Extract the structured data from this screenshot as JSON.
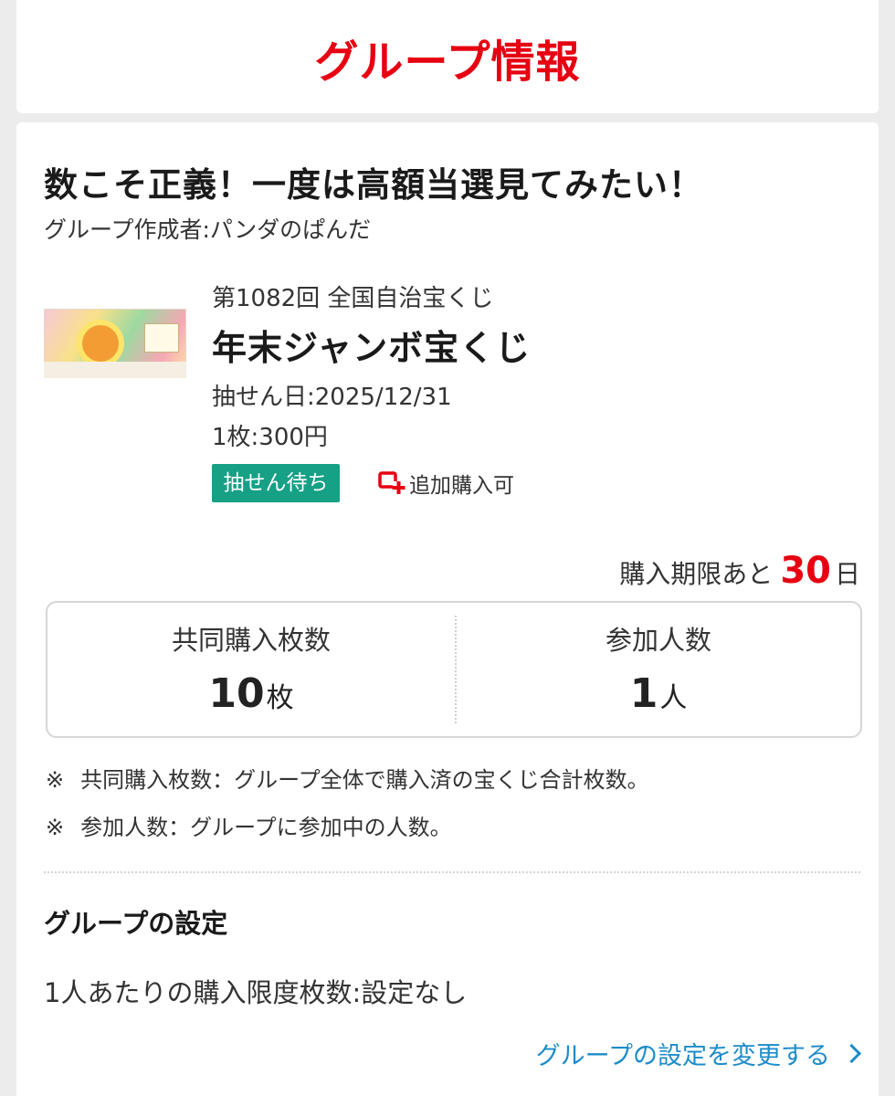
{
  "header": {
    "title": "グループ情報"
  },
  "group": {
    "name": "数こそ正義！一度は高額当選見てみたい！",
    "creator": "グループ作成者:パンダのぱんだ"
  },
  "lottery": {
    "round": "第1082回 全国自治宝くじ",
    "name": "年末ジャンボ宝くじ",
    "draw_date": "抽せん日:2025/12/31",
    "price": "1枚:300円",
    "status_badge": "抽せん待ち",
    "additional_purchase": "追加購入可",
    "image_icon": "lottery-ticket-image",
    "badge_color": "#16a085"
  },
  "deadline": {
    "prefix": "購入期限あと",
    "days": "30",
    "suffix": "日"
  },
  "stats": {
    "joint_label": "共同購入枚数",
    "joint_value": "10",
    "joint_unit": "枚",
    "members_label": "参加人数",
    "members_value": "1",
    "members_unit": "人"
  },
  "notes": {
    "mark": "※",
    "joint": "共同購入枚数：グループ全体で購入済の宝くじ合計枚数。",
    "members": "参加人数：グループに参加中の人数。"
  },
  "settings": {
    "title": "グループの設定",
    "limit": "1人あたりの購入限度枚数:設定なし",
    "change_link": "グループの設定を変更する"
  },
  "colors": {
    "accent": "#e60012",
    "link": "#1c8cc9",
    "badge": "#16a085"
  }
}
